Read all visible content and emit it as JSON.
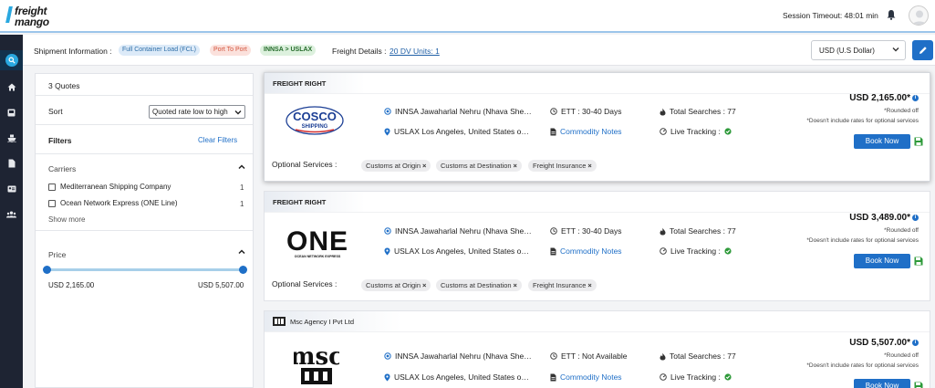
{
  "header": {
    "logo_line1": "freight",
    "logo_line2": "mango",
    "session_timeout": "Session Timeout: 48:01 min"
  },
  "colors": {
    "accent": "#1f6fc7",
    "brand": "#29a8e0",
    "sidebar": "#1e2433"
  },
  "sidebar": {
    "items": [
      {
        "icon": "search-icon",
        "active": true
      },
      {
        "icon": "home-icon"
      },
      {
        "icon": "inbox-icon"
      },
      {
        "icon": "ship-icon"
      },
      {
        "icon": "document-icon"
      },
      {
        "icon": "id-card-icon"
      },
      {
        "icon": "users-icon"
      }
    ]
  },
  "info": {
    "shipment_label": "Shipment Information :",
    "load_type": "Full Container Load (FCL)",
    "service": "Port To Port",
    "route": "INNSA > USLAX",
    "freight_label": "Freight Details :",
    "freight_value": "20 DV Units: 1",
    "currency": "USD (U.S Dollar)"
  },
  "filters": {
    "quote_count": "3 Quotes",
    "sort_label": "Sort",
    "sort_value": "Quoted rate low to high",
    "filters_label": "Filters",
    "clear_label": "Clear Filters",
    "carriers_label": "Carriers",
    "carriers": [
      {
        "name": "Mediterranean Shipping Company",
        "count": "1"
      },
      {
        "name": "Ocean Network Express (ONE Line)",
        "count": "1"
      }
    ],
    "show_more": "Show more",
    "price_label": "Price",
    "price_min": "USD 2,165.00",
    "price_max": "USD 5,507.00",
    "price_range_fraction": [
      0,
      1
    ]
  },
  "quotes": [
    {
      "provider": "FREIGHT RIGHT",
      "carrier_logo": "COSCO SHIPPING",
      "carrier_logo_line1": "COSCO",
      "carrier_logo_line2": "SHIPPING",
      "origin": "INNSA Jawaharlal Nehru (Nhava Sheva), India",
      "destination": "USLAX Los Angeles, United States of America",
      "ett": "ETT : 30-40 Days",
      "commodity": "Commodity Notes",
      "searches": "Total Searches : 77",
      "tracking": "Live Tracking :",
      "optional_label": "Optional Services :",
      "optional": [
        "Customs at Origin",
        "Customs at Destination",
        "Freight Insurance"
      ],
      "price": "USD 2,165.00*",
      "note1": "*Rounded off",
      "note2": "*Doesn't include rates for optional services",
      "book": "Book Now"
    },
    {
      "provider": "FREIGHT RIGHT",
      "carrier_logo": "ONE",
      "carrier_logo_line1": "ONE",
      "carrier_logo_line2": "OCEAN NETWORK EXPRESS",
      "origin": "INNSA Jawaharlal Nehru (Nhava Sheva), India",
      "destination": "USLAX Los Angeles, United States of America",
      "ett": "ETT : 30-40 Days",
      "commodity": "Commodity Notes",
      "searches": "Total Searches : 77",
      "tracking": "Live Tracking :",
      "optional_label": "Optional Services :",
      "optional": [
        "Customs at Origin",
        "Customs at Destination",
        "Freight Insurance"
      ],
      "price": "USD 3,489.00*",
      "note1": "*Rounded off",
      "note2": "*Doesn't include rates for optional services",
      "book": "Book Now"
    },
    {
      "provider": "Msc Agency I Pvt Ltd",
      "carrier_logo": "msc",
      "carrier_logo_line1": "msc",
      "origin": "INNSA Jawaharlal Nehru (Nhava Sheva), India",
      "destination": "USLAX Los Angeles, United States of America",
      "ett": "ETT : Not Available",
      "commodity": "Commodity Notes",
      "searches": "Total Searches : 77",
      "tracking": "Live Tracking :",
      "price": "USD 5,507.00*",
      "note1": "*Rounded off",
      "note2": "*Doesn't include rates for optional services",
      "book": "Book Now"
    }
  ]
}
